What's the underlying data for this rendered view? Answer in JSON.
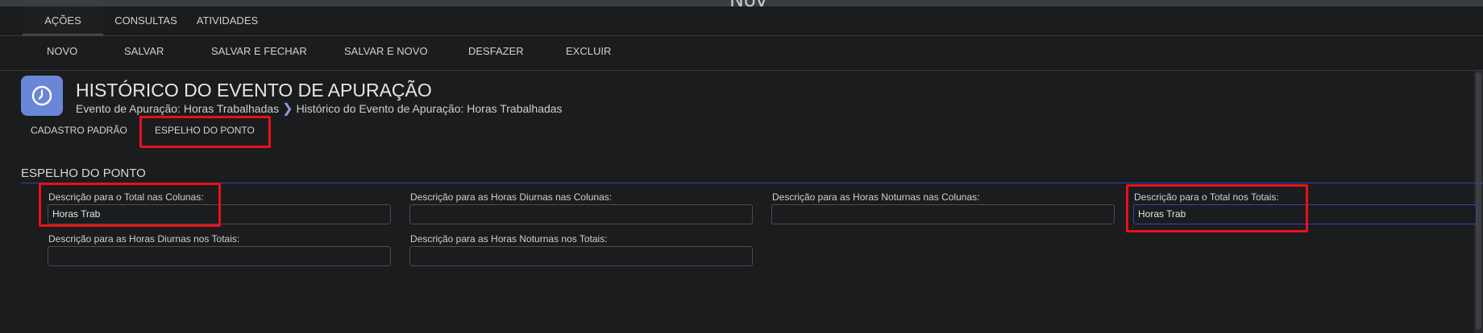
{
  "window": {
    "ghost_title": "Nov"
  },
  "top_tabs": [
    {
      "label": "AÇÕES"
    },
    {
      "label": "CONSULTAS"
    },
    {
      "label": "ATIVIDADES"
    }
  ],
  "actions": [
    {
      "label": "NOVO"
    },
    {
      "label": "SALVAR"
    },
    {
      "label": "SALVAR E FECHAR"
    },
    {
      "label": "SALVAR E NOVO"
    },
    {
      "label": "DESFAZER"
    },
    {
      "label": "EXCLUIR"
    }
  ],
  "header": {
    "icon": "clock-icon",
    "title": "HISTÓRICO DO EVENTO DE APURAÇÃO",
    "breadcrumb": [
      "Evento de Apuração: Horas Trabalhadas",
      "Histórico do Evento de Apuração: Horas Trabalhadas"
    ]
  },
  "sub_tabs": [
    {
      "label": "CADASTRO PADRÃO"
    },
    {
      "label": "ESPELHO DO PONTO"
    }
  ],
  "section": {
    "title": "ESPELHO DO PONTO",
    "fields": [
      {
        "label": "Descrição para o Total nas Colunas:",
        "value": "Horas Trab"
      },
      {
        "label": "Descrição para as Horas Diurnas nas Colunas:",
        "value": ""
      },
      {
        "label": "Descrição para as Horas Noturnas nas Colunas:",
        "value": ""
      },
      {
        "label": "Descrição para o Total nos Totais:",
        "value": "Horas Trab"
      },
      {
        "label": "Descrição para as Horas Diurnas nos Totais:",
        "value": ""
      },
      {
        "label": "Descrição para as Horas Noturnas nos Totais:",
        "value": ""
      }
    ]
  },
  "colors": {
    "background": "#1b1c1e",
    "accent": "#2f46b5",
    "icon_bg": "#6a86d6",
    "highlight": "#e8101c"
  }
}
